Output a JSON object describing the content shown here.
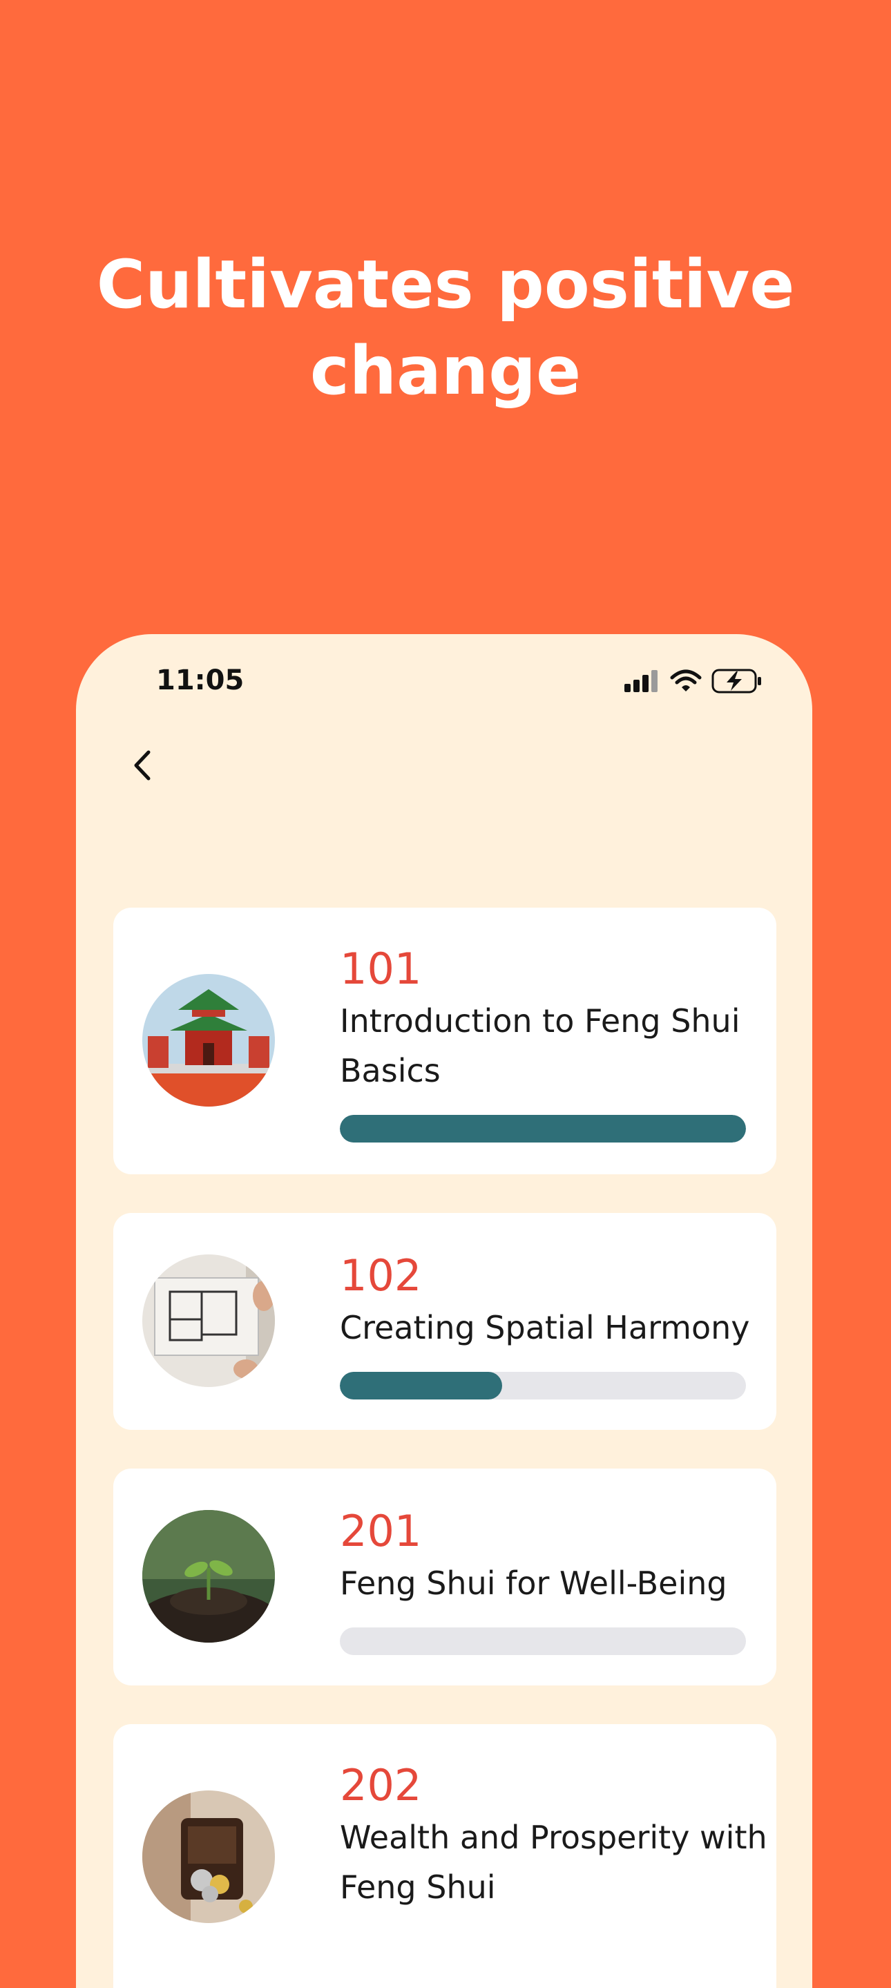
{
  "headline": "Cultivates positive change",
  "status_bar": {
    "time": "11:05"
  },
  "icons": {
    "back": "chevron-left-icon",
    "signal": "cellular-signal-icon",
    "wifi": "wifi-icon",
    "battery": "battery-charging-icon"
  },
  "colors": {
    "background": "#FF6A3D",
    "phone_bg": "#FFF1DC",
    "code": "#E5483A",
    "progress_fill": "#2F6F78",
    "progress_track": "#E6E6EA"
  },
  "courses": [
    {
      "code": "101",
      "title": "Introduction to Feng Shui Basics",
      "progress": 1.0,
      "image": "pagoda-temple"
    },
    {
      "code": "102",
      "title": "Creating Spatial Harmony",
      "progress": 0.4,
      "image": "floor-plan"
    },
    {
      "code": "201",
      "title": "Feng Shui for Well-Being",
      "progress": 0.0,
      "image": "seedling-soil"
    },
    {
      "code": "202",
      "title": "Wealth and Prosperity with Feng Shui",
      "progress": null,
      "image": "treasure-coins"
    }
  ]
}
